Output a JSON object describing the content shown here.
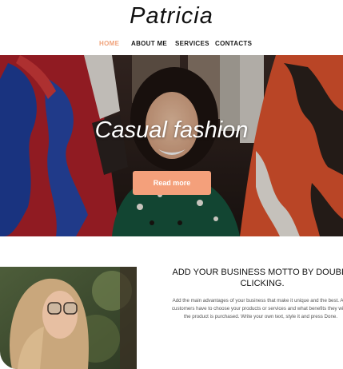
{
  "header": {
    "logo": "Patricia",
    "nav": [
      {
        "label": "HOME",
        "active": true
      },
      {
        "label": "ABOUT ME",
        "active": false
      },
      {
        "label": "SERVICES",
        "active": false
      },
      {
        "label": "CONTACTS",
        "active": false
      }
    ]
  },
  "hero": {
    "title": "Casual fashion",
    "button_label": "Read more"
  },
  "about": {
    "motto_lines": [
      "ADD YOUR BUSINESS MOTTO BY DOUBLE",
      "CLICKING."
    ],
    "body_lines": [
      "Add the main advantages of your business that make it unique and the best. Add",
      "customers have to choose your products or services and what benefits they will g",
      "the product is purchased. Write your own text, style it and press Done."
    ]
  },
  "colors": {
    "accent": "#f4a07b",
    "nav_active": "#f0a27a",
    "text": "#111111"
  }
}
